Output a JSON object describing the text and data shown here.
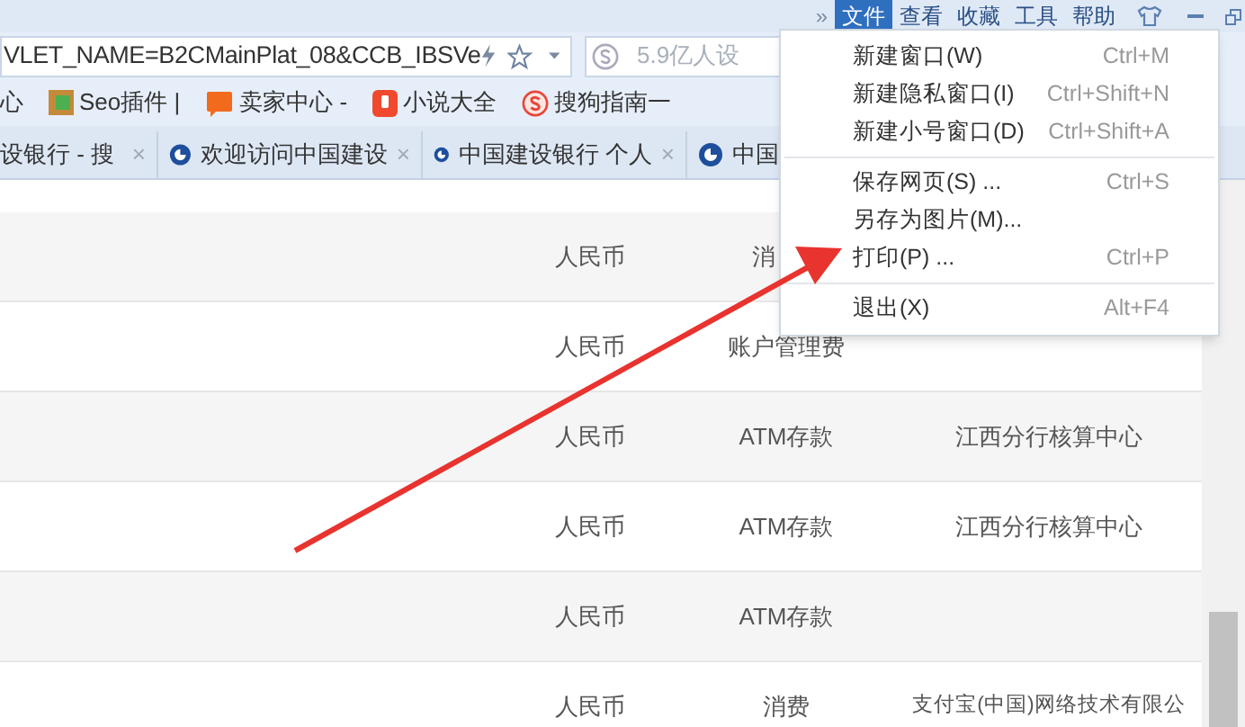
{
  "menu_bar": {
    "overflow": "»",
    "items": [
      {
        "label": "文件",
        "selected": true
      },
      {
        "label": "查看",
        "selected": false
      },
      {
        "label": "收藏",
        "selected": false
      },
      {
        "label": "工具",
        "selected": false
      },
      {
        "label": "帮助",
        "selected": false
      }
    ]
  },
  "address_bar": {
    "url": "VLET_NAME=B2CMainPlat_08&CCB_IBSVe",
    "search_placeholder": "5.9亿人设"
  },
  "bookmarks": [
    {
      "label": "心"
    },
    {
      "label": "Seo插件 |"
    },
    {
      "label": "卖家中心 -"
    },
    {
      "label": "小说大全"
    },
    {
      "label": "搜狗指南一"
    }
  ],
  "tabs": [
    {
      "label": "设银行 - 搜",
      "close": "×"
    },
    {
      "label": "欢迎访问中国建设",
      "close": "×"
    },
    {
      "label": "中国建设银行 个人",
      "close": "×"
    },
    {
      "label": "中国"
    }
  ],
  "table": {
    "rows": [
      {
        "column_1": "人民币",
        "column_2": "消",
        "column_3": ""
      },
      {
        "column_1": "人民币",
        "column_2": "账户管理费",
        "column_3": ""
      },
      {
        "column_1": "人民币",
        "column_2": "ATM存款",
        "column_3": "江西分行核算中心"
      },
      {
        "column_1": "人民币",
        "column_2": "ATM存款",
        "column_3": "江西分行核算中心"
      },
      {
        "column_1": "人民币",
        "column_2": "ATM存款",
        "column_3": ""
      },
      {
        "column_1": "人民币",
        "column_2": "消费",
        "column_3": "支付宝(中国)网络技术有限公"
      }
    ]
  },
  "file_menu": {
    "groups": [
      [
        {
          "label": "新建窗口(W)",
          "shortcut": "Ctrl+M"
        },
        {
          "label": "新建隐私窗口(I)",
          "shortcut": "Ctrl+Shift+N"
        },
        {
          "label": "新建小号窗口(D)",
          "shortcut": "Ctrl+Shift+A"
        }
      ],
      [
        {
          "label": "保存网页(S) ...",
          "shortcut": "Ctrl+S"
        },
        {
          "label": "另存为图片(M)..."
        },
        {
          "label": "打印(P) ...",
          "shortcut": "Ctrl+P"
        }
      ],
      [
        {
          "label": "退出(X)",
          "shortcut": "Alt+F4"
        }
      ]
    ]
  }
}
